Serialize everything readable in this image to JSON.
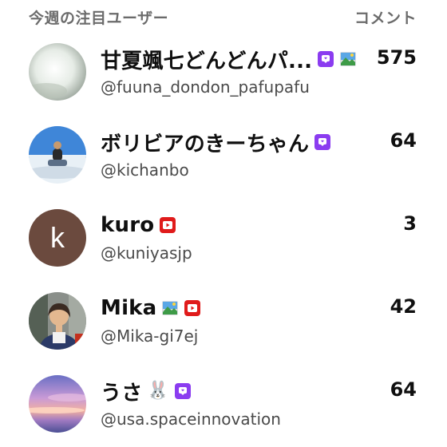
{
  "header": {
    "title": "今週の注目ユーザー",
    "column_label": "コメント"
  },
  "users": [
    {
      "name": "甘夏颯七どんどんパ...",
      "handle": "@fuuna_dondon_pafupafu",
      "count": "575"
    },
    {
      "name": "ボリビアのきーちゃん",
      "handle": "@kichanbo",
      "count": "64"
    },
    {
      "name": "kuro",
      "handle": "@kuniyasjp",
      "count": "3",
      "avatar_letter": "k"
    },
    {
      "name": "Mika",
      "handle": "@Mika-gi7ej",
      "count": "42"
    },
    {
      "name": "うさ",
      "handle": "@usa.spaceinnovation",
      "count": "64",
      "name_emoji": "🐰"
    }
  ],
  "colors": {
    "membership_badge": "#8b3cf0",
    "youtube_badge": "#e01b1b",
    "kuro_avatar": "#6b4a3e"
  },
  "icons": {
    "membership": "membership-badge-icon",
    "youtube": "youtube-badge-icon",
    "picture": "landscape-picture-icon"
  }
}
